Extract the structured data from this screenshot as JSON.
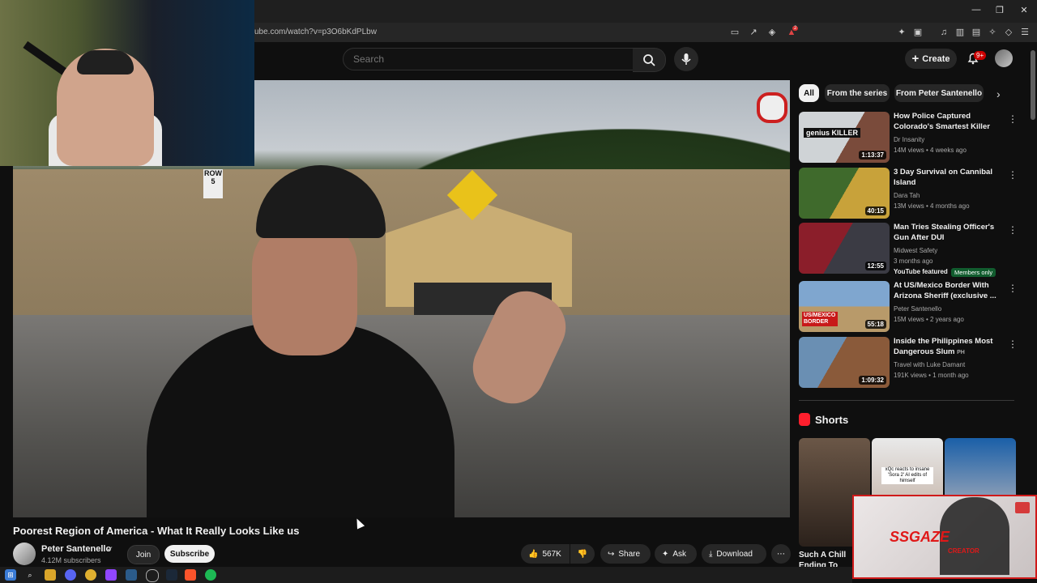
{
  "browser": {
    "url": "ube.com/watch?v=p3O6bKdPLbw",
    "window_controls": [
      "—",
      "❐",
      "✕"
    ],
    "extension_badge": "2"
  },
  "header": {
    "search_placeholder": "Search",
    "create_label": "Create",
    "notifications_badge": "9+"
  },
  "video": {
    "title": "Poorest Region of America - What It Really Looks Like us",
    "channel": "Peter Santenello",
    "subscribers": "4.12M subscribers",
    "join_label": "Join",
    "subscribe_label": "Subscribe",
    "likes": "567K",
    "share_label": "Share",
    "ask_label": "Ask",
    "download_label": "Download",
    "more_label": "⋯",
    "scene_sign_row": "ROW 5"
  },
  "chips": [
    "All",
    "From the series",
    "From Peter Santenello"
  ],
  "recommendations": [
    {
      "title": "How Police Captured Colorado's Smartest Killer",
      "channel": "Dr Insanity",
      "meta": "14M views • 4 weeks ago",
      "duration": "1:13:37",
      "thumb_text": "genius KILLER",
      "thumb_colors": [
        "#cfd3d6",
        "#7a4b3b"
      ]
    },
    {
      "title": "3 Day Survival on Cannibal Island",
      "channel": "Dara Tah",
      "meta": "13M views • 4 months ago",
      "duration": "40:15",
      "thumb_text": "",
      "thumb_colors": [
        "#3f6a2c",
        "#c8a23a"
      ]
    },
    {
      "title": "Man Tries Stealing Officer's Gun After DUI",
      "channel": "Midwest Safety",
      "meta": "3 months ago",
      "featured": "YouTube featured",
      "members": "Members only",
      "duration": "12:55",
      "thumb_text": "",
      "thumb_colors": [
        "#8b1e2a",
        "#3b3b44"
      ]
    },
    {
      "title": "At US/Mexico Border With Arizona Sheriff (exclusive ...",
      "channel": "Peter Santenello",
      "meta": "15M views • 2 years ago",
      "duration": "55:18",
      "thumb_text": "US/MEXICO BORDER",
      "thumb_colors": [
        "#7fa6cf",
        "#b89a6a"
      ]
    },
    {
      "title": "Inside the Philippines Most Dangerous Slum",
      "title_suffix": "PH",
      "channel": "Travel with Luke Damant",
      "meta": "191K views • 1 month ago",
      "duration": "1:09:32",
      "thumb_text": "",
      "thumb_colors": [
        "#6a8fb3",
        "#8a5a3a"
      ]
    }
  ],
  "shorts": {
    "label": "Shorts",
    "items": [
      {
        "title": "Such A Chill Ending To",
        "colors": [
          "#6b5747",
          "#2b211b"
        ]
      },
      {
        "overlay": "xQc reacts to insane 'Sora 2' AI edits of himself",
        "colors": [
          "#e9e9e9",
          "#b7a08f"
        ]
      },
      {
        "colors": [
          "#1a5fa8",
          "#e5d0c2"
        ]
      }
    ]
  },
  "overlay_promo": {
    "text": "SSGAZE",
    "subtext": "CREATOR"
  },
  "colors": {
    "bg": "#0f0f0f",
    "accent_red": "#cc0000",
    "surface": "#272727"
  }
}
